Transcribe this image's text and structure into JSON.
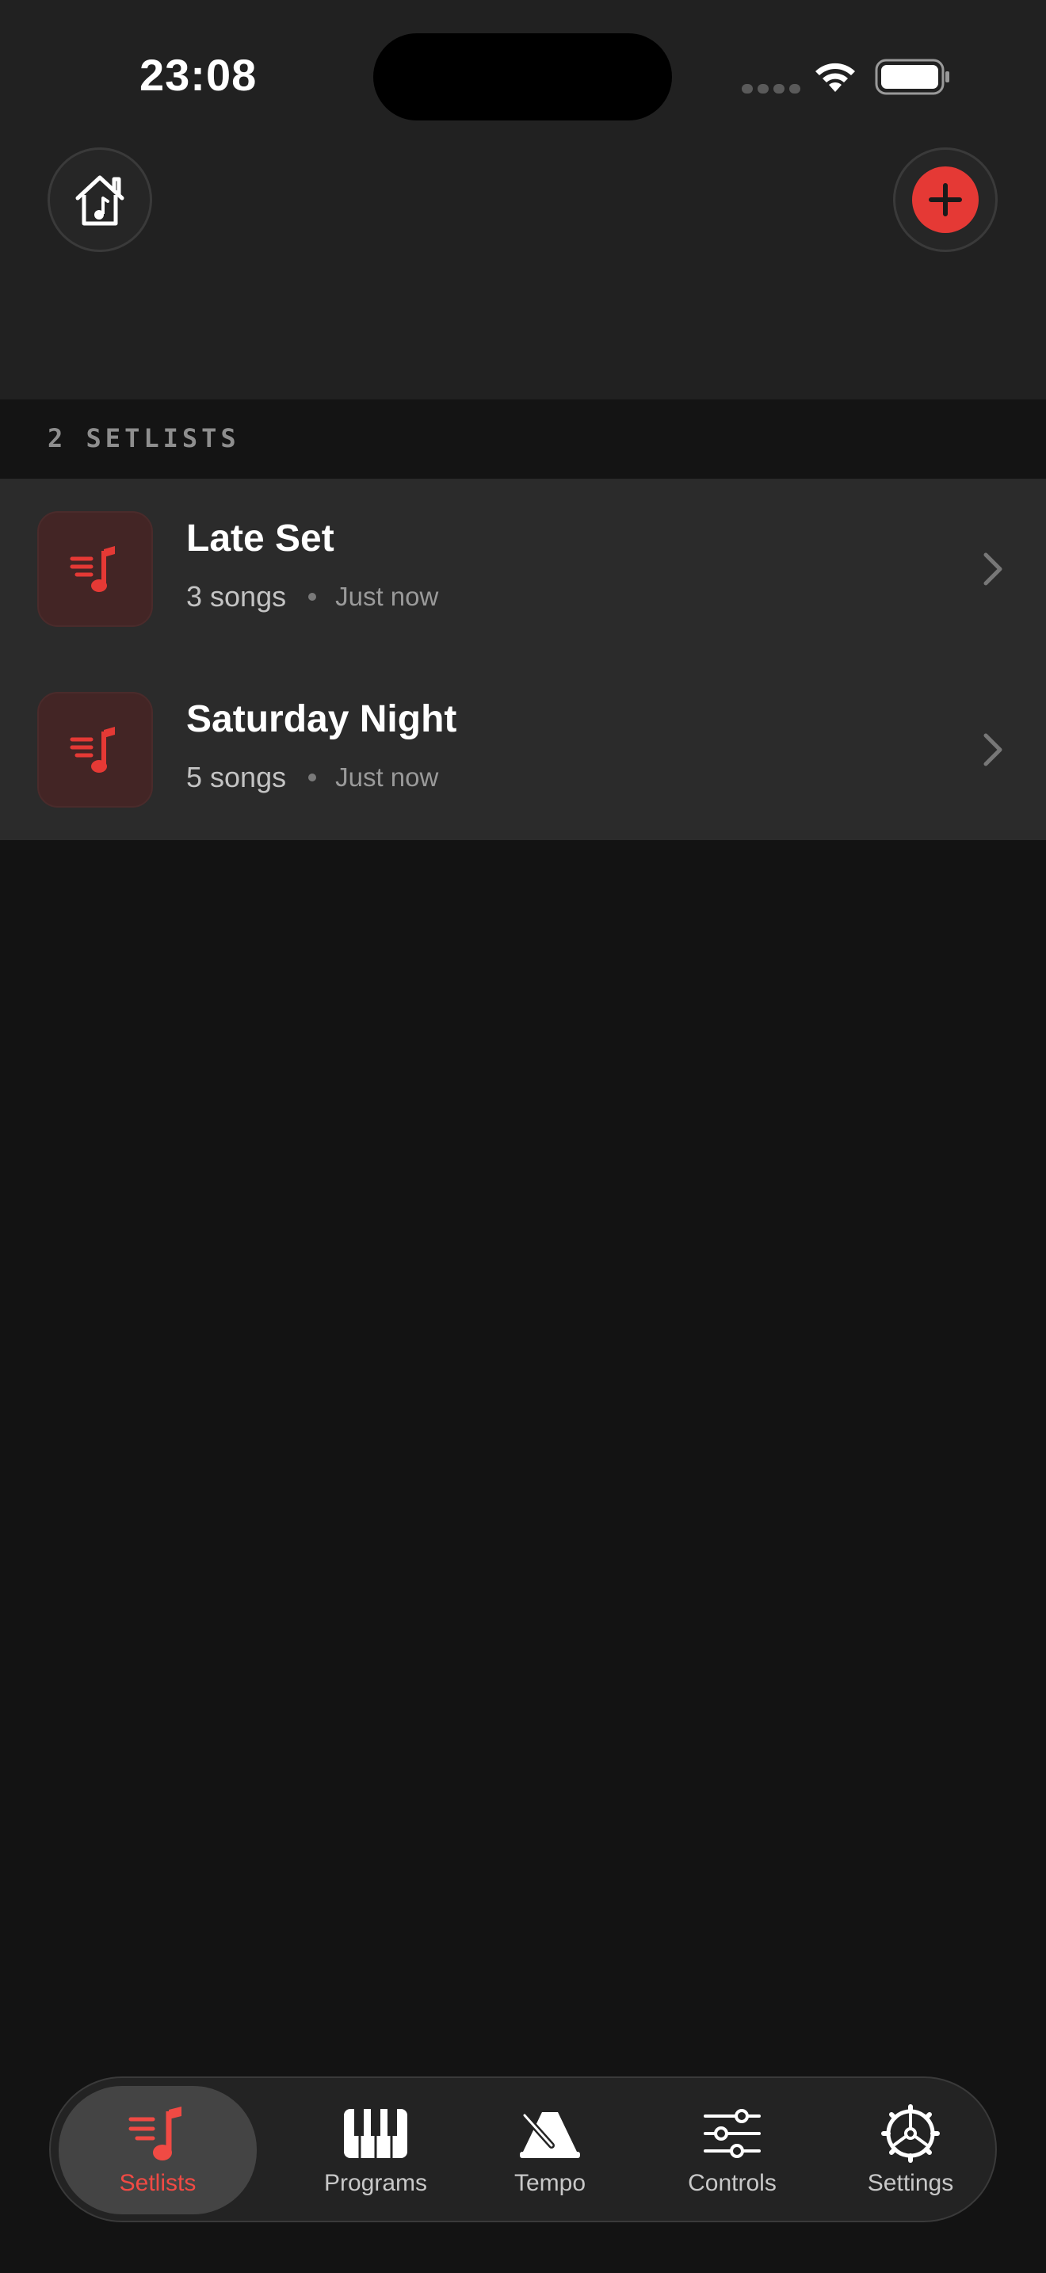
{
  "status_bar": {
    "time": "23:08"
  },
  "section": {
    "label": "2 SETLISTS"
  },
  "setlists": [
    {
      "title": "Late Set",
      "count": "3 songs",
      "updated": "Just now"
    },
    {
      "title": "Saturday Night",
      "count": "5 songs",
      "updated": "Just now"
    }
  ],
  "tabs": [
    {
      "label": "Setlists",
      "icon": "music-list-icon",
      "active": true
    },
    {
      "label": "Programs",
      "icon": "piano-keys-icon",
      "active": false
    },
    {
      "label": "Tempo",
      "icon": "metronome-icon",
      "active": false
    },
    {
      "label": "Controls",
      "icon": "sliders-icon",
      "active": false
    },
    {
      "label": "Settings",
      "icon": "gear-icon",
      "active": false
    }
  ],
  "colors": {
    "accent": "#e53935",
    "background": "#131313",
    "header": "#212121",
    "row": "#2b2b2b"
  }
}
